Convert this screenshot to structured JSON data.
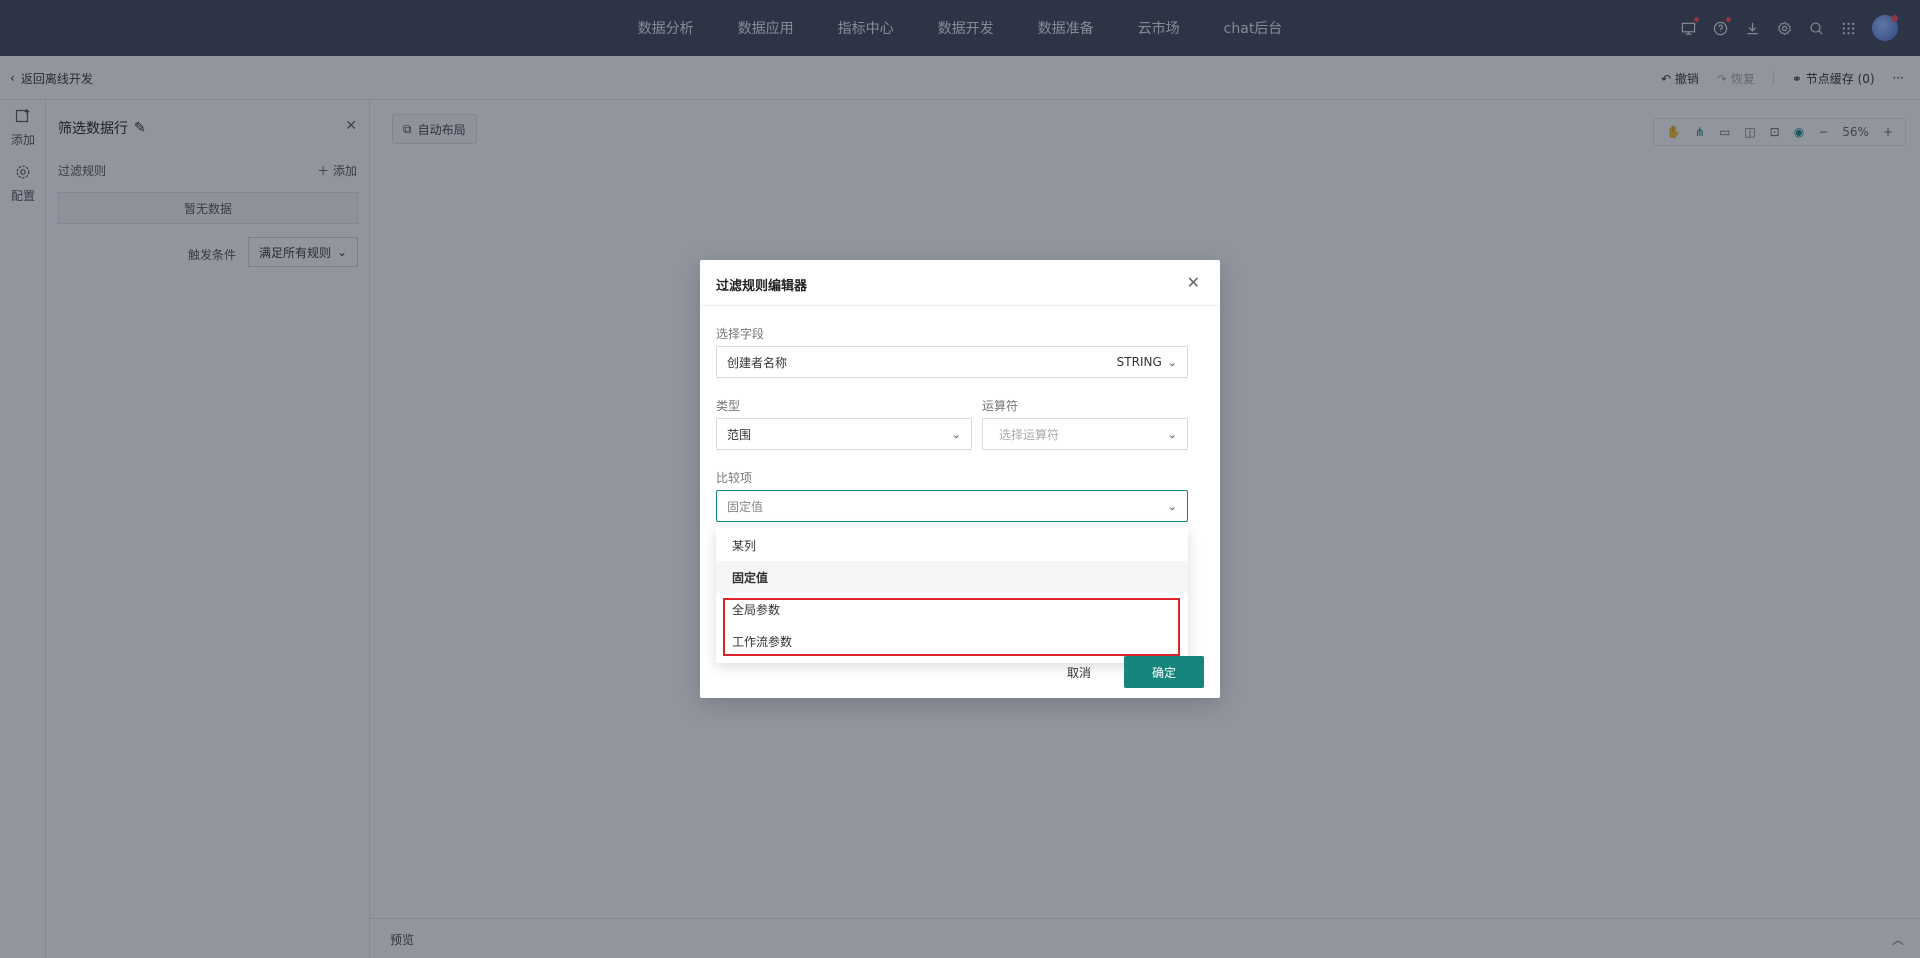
{
  "topnav": {
    "items": [
      "数据分析",
      "数据应用",
      "指标中心",
      "数据开发",
      "数据准备",
      "云市场",
      "chat后台"
    ],
    "icons": [
      "screen-icon",
      "help-icon",
      "download-icon",
      "settings-icon",
      "search-icon",
      "apps-grid-icon"
    ]
  },
  "subheader": {
    "back_label": "返回离线开发",
    "undo_label": "撤销",
    "redo_label": "恢复",
    "node_cache_label": "节点缓存 (0)"
  },
  "rail": {
    "add_label": "添加",
    "config_label": "配置"
  },
  "panel": {
    "title": "筛选数据行",
    "rules_label": "过滤规则",
    "add_label": "添加",
    "empty_text": "暂无数据",
    "trigger_label": "触发条件",
    "trigger_value": "满足所有规则"
  },
  "canvas": {
    "auto_layout_label": "自动布局",
    "zoom_value": "56%"
  },
  "preview": {
    "label": "预览"
  },
  "modal": {
    "title": "过滤规则编辑器",
    "field_label": "选择字段",
    "field_value": "创建者名称",
    "field_type": "STRING",
    "type_label": "类型",
    "type_value": "范围",
    "operator_label": "运算符",
    "operator_placeholder": "选择运算符",
    "compare_label": "比较项",
    "compare_value": "固定值",
    "options": [
      "某列",
      "固定值",
      "全局参数",
      "工作流参数"
    ],
    "cancel_label": "取消",
    "ok_label": "确定"
  },
  "colors": {
    "accent": "#15857d",
    "highlight_border": "#d9252b",
    "topnav_bg": "#3f4656"
  }
}
